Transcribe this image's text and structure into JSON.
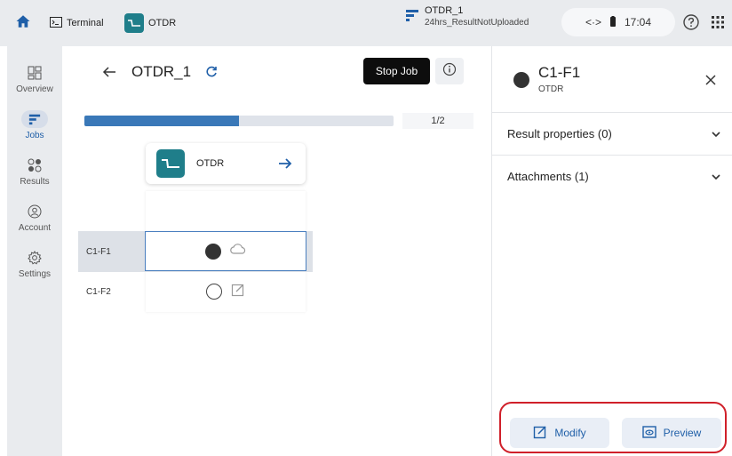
{
  "topbar": {
    "terminal_label": "Terminal",
    "otdr_label": "OTDR",
    "job_name": "OTDR_1",
    "job_status": "24hrs_ResultNotUploaded",
    "network_indicator": "<·>",
    "time": "17:04"
  },
  "sidebar": {
    "items": [
      {
        "label": "Overview",
        "icon": "overview-icon"
      },
      {
        "label": "Jobs",
        "icon": "jobs-icon",
        "active": true
      },
      {
        "label": "Results",
        "icon": "results-icon"
      },
      {
        "label": "Account",
        "icon": "account-icon"
      },
      {
        "label": "Settings",
        "icon": "settings-icon"
      }
    ]
  },
  "main": {
    "title": "OTDR_1",
    "stop_label": "Stop Job",
    "progress_fraction": 0.5,
    "progress_text": "1/2",
    "test_label": "OTDR",
    "rows": [
      {
        "label": "C1-F1",
        "status": "completed",
        "selected": true
      },
      {
        "label": "C1-F2",
        "status": "pending",
        "selected": false
      }
    ]
  },
  "panel": {
    "title": "C1-F1",
    "subtitle": "OTDR",
    "result_properties": "Result properties (0)",
    "attachments": "Attachments (1)",
    "modify_label": "Modify",
    "preview_label": "Preview"
  },
  "colors": {
    "accent": "#1f5fa8",
    "progress": "#3a78b8",
    "otdr_badge": "#1f7e8a",
    "highlight_border": "#d0202a"
  }
}
